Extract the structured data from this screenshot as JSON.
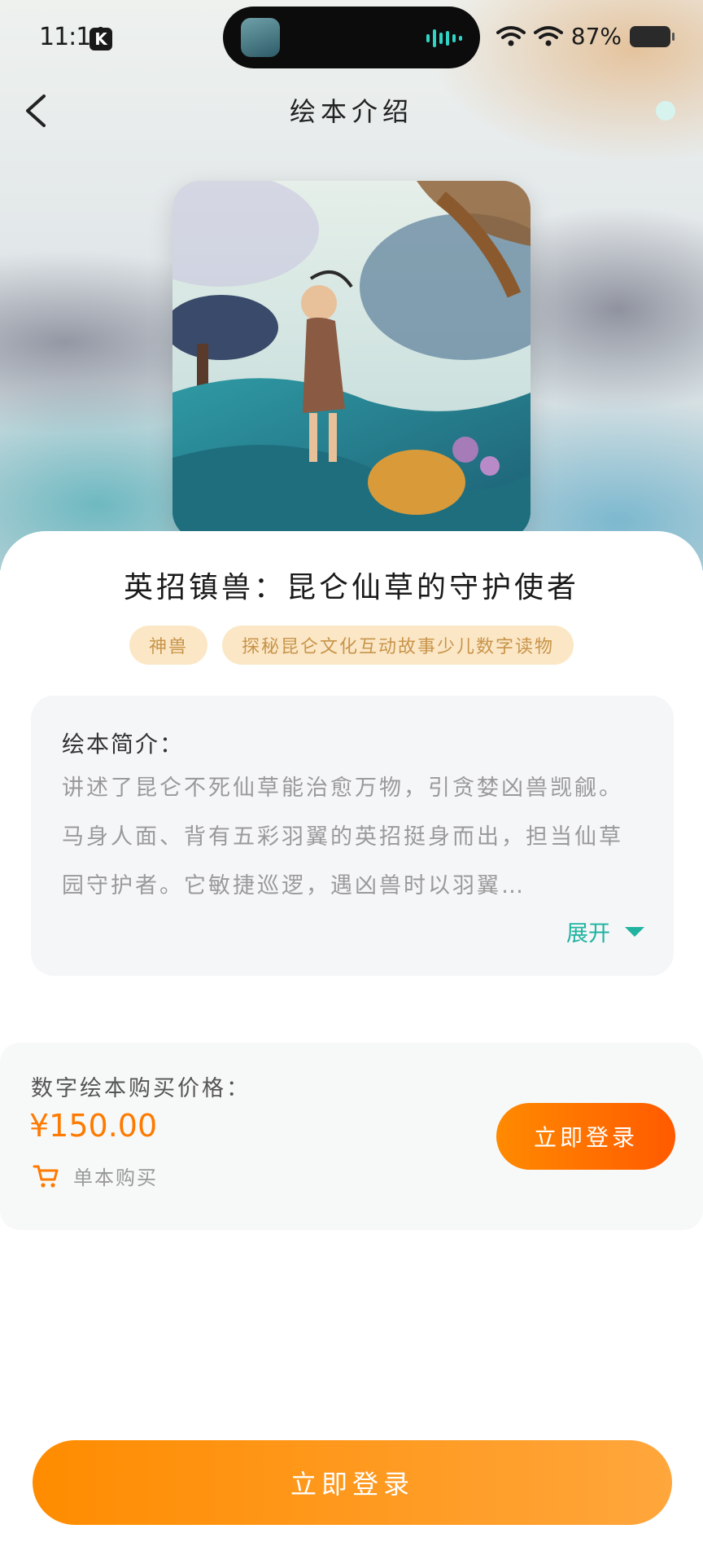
{
  "status_bar": {
    "time": "11:14",
    "app_badge": "K",
    "battery_percent": "87%"
  },
  "nav": {
    "title": "绘本介绍"
  },
  "book": {
    "title": "英招镇兽：昆仑仙草的守护使者",
    "tags": [
      "神兽",
      "探秘昆仑文化互动故事少儿数字读物"
    ]
  },
  "intro": {
    "label": "绘本简介：",
    "text": "讲述了昆仑不死仙草能治愈万物，引贪婪凶兽觊觎。马身人面、背有五彩羽翼的英招挺身而出，担当仙草园守护者。它敏捷巡逻，遇凶兽时以羽翼…",
    "expand_label": "展开"
  },
  "purchase": {
    "price_label": "数字绘本购买价格：",
    "price": "¥150.00",
    "single_label": "单本购买",
    "login_label": "立即登录"
  },
  "bottom": {
    "login_label": "立即登录"
  },
  "colors": {
    "accent_orange": "#ff7a00",
    "teal": "#1fb3a0",
    "tag_bg": "#fbe7c6"
  }
}
